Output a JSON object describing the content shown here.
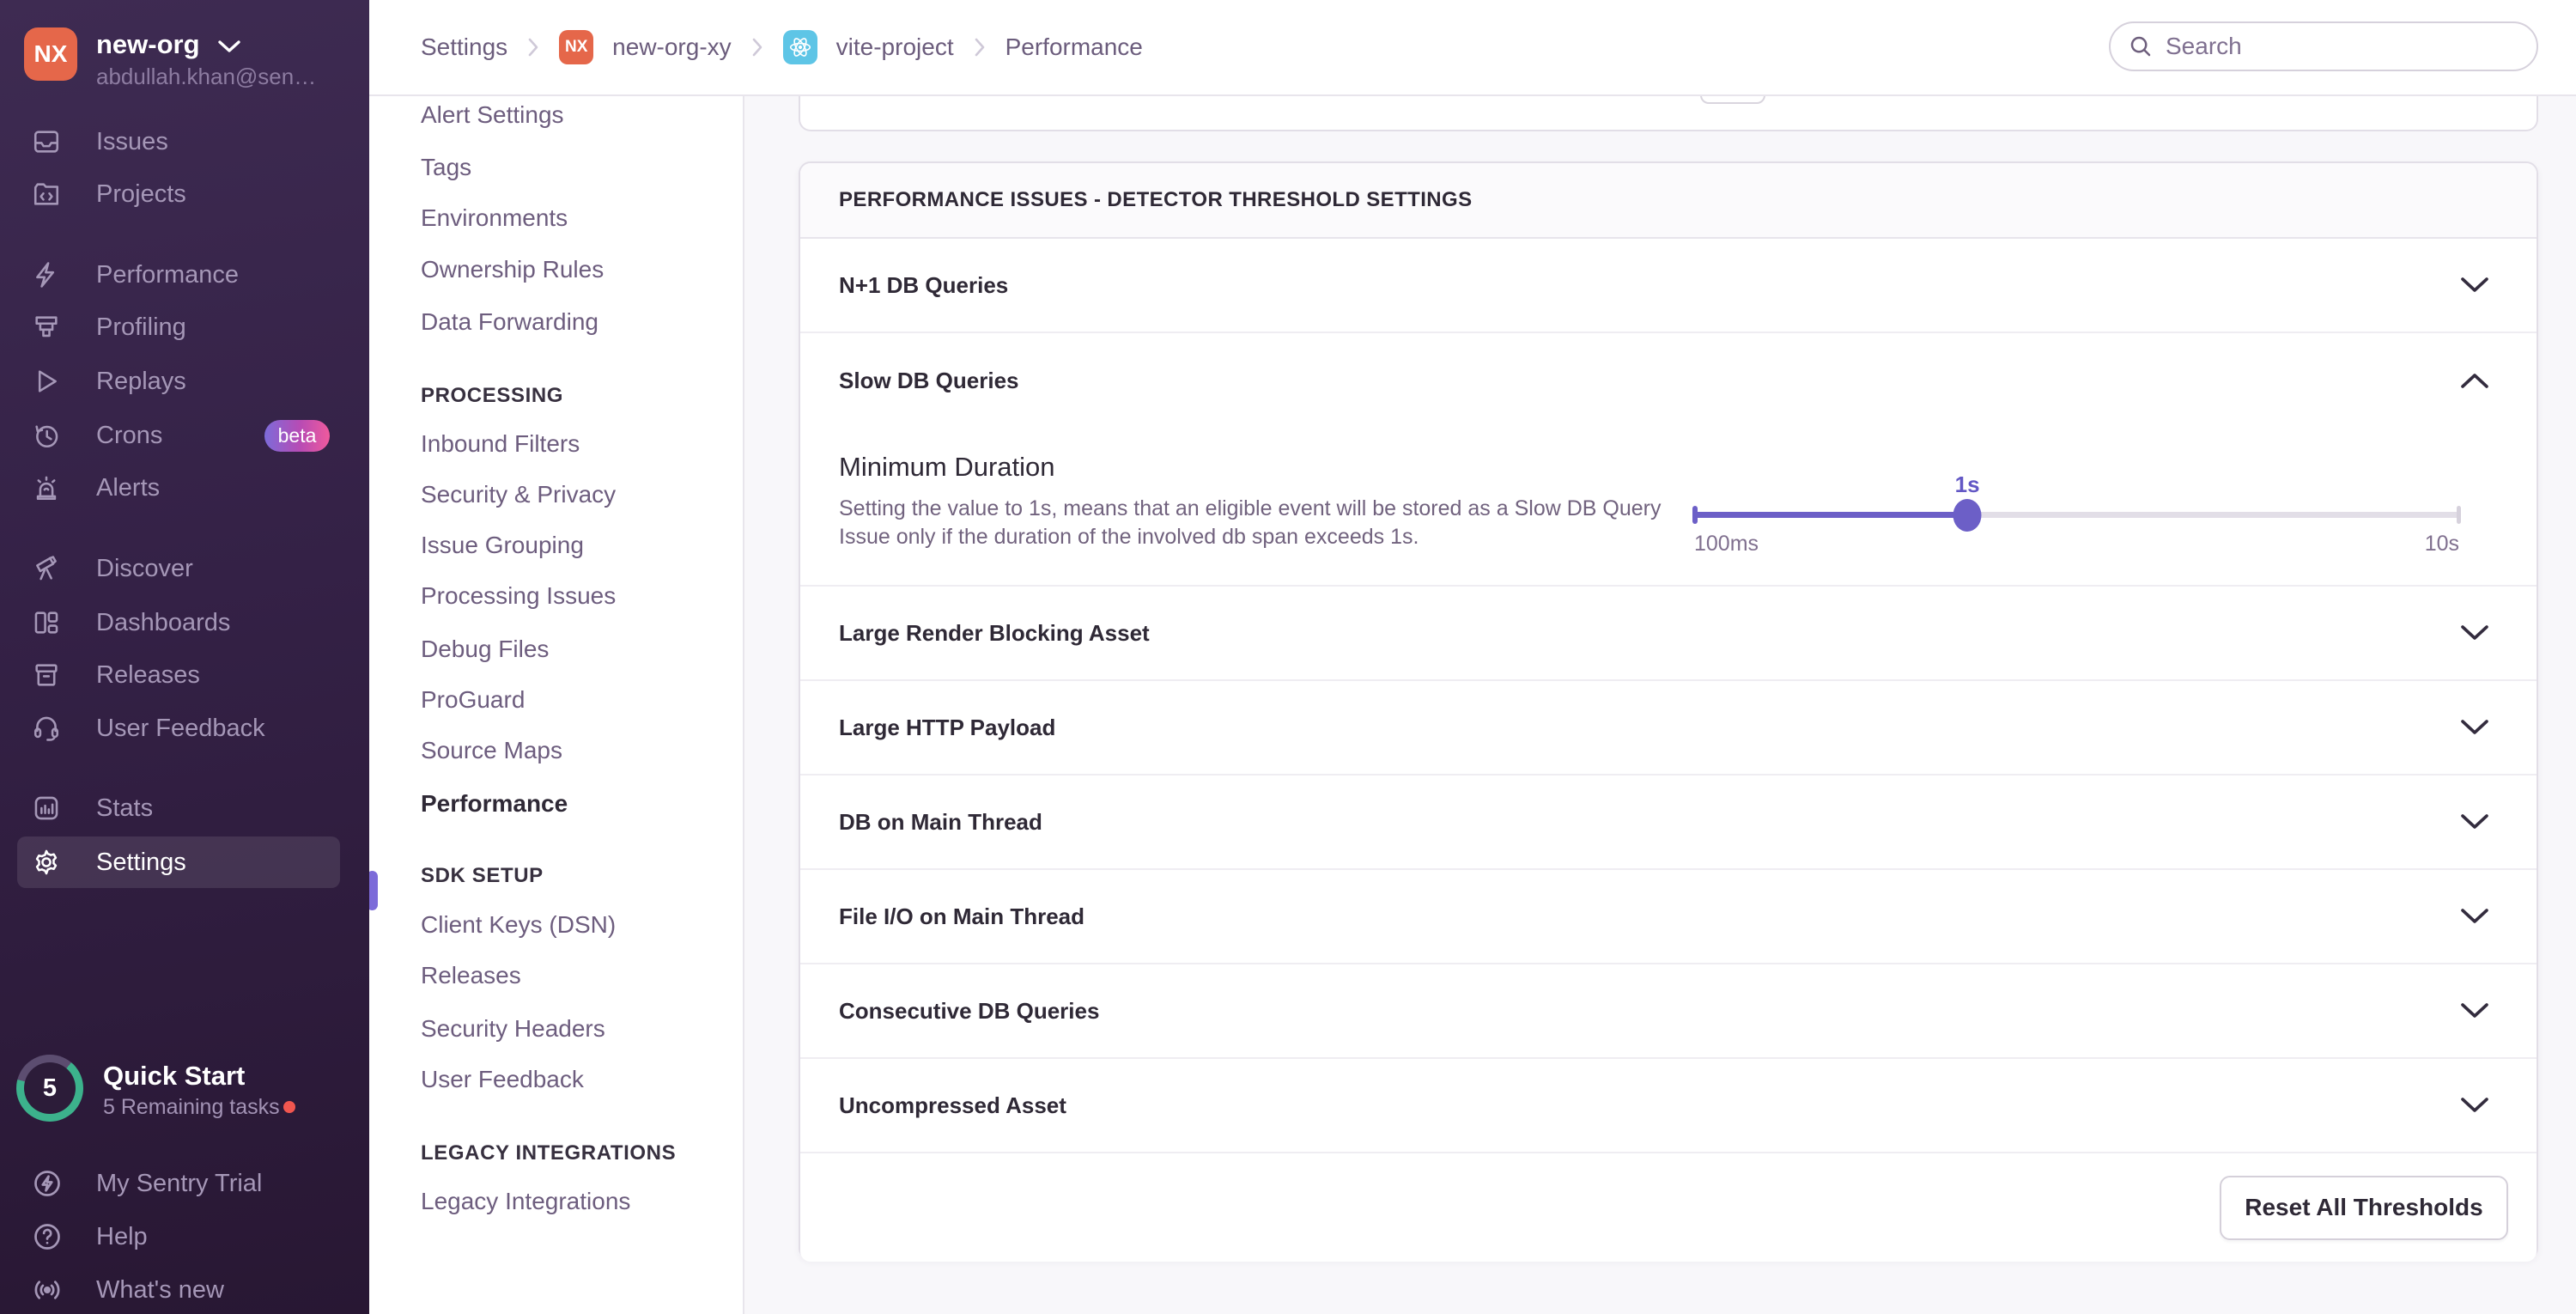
{
  "org": {
    "initials": "NX",
    "name": "new-org",
    "email": "abdullah.khan@sen…"
  },
  "sidebar": {
    "items": [
      {
        "label": "Issues"
      },
      {
        "label": "Projects"
      },
      {
        "label": "Performance"
      },
      {
        "label": "Profiling"
      },
      {
        "label": "Replays"
      },
      {
        "label": "Crons",
        "badge": "beta"
      },
      {
        "label": "Alerts"
      },
      {
        "label": "Discover"
      },
      {
        "label": "Dashboards"
      },
      {
        "label": "Releases"
      },
      {
        "label": "User Feedback"
      },
      {
        "label": "Stats"
      },
      {
        "label": "Settings"
      }
    ]
  },
  "quickstart": {
    "count": "5",
    "title": "Quick Start",
    "subtitle": "5 Remaining tasks"
  },
  "sidebar_footer": {
    "items": [
      {
        "label": "My Sentry Trial"
      },
      {
        "label": "Help"
      },
      {
        "label": "What's new"
      }
    ]
  },
  "breadcrumb": {
    "org_chip": "NX",
    "items": [
      "Settings",
      "new-org-xy",
      "vite-project",
      "Performance"
    ]
  },
  "search": {
    "placeholder": "Search"
  },
  "settings_nav": {
    "groups": [
      {
        "header": "",
        "items": [
          {
            "label": "Alert Settings"
          },
          {
            "label": "Tags"
          },
          {
            "label": "Environments"
          },
          {
            "label": "Ownership Rules"
          },
          {
            "label": "Data Forwarding"
          }
        ]
      },
      {
        "header": "PROCESSING",
        "items": [
          {
            "label": "Inbound Filters"
          },
          {
            "label": "Security & Privacy"
          },
          {
            "label": "Issue Grouping"
          },
          {
            "label": "Processing Issues"
          },
          {
            "label": "Debug Files"
          },
          {
            "label": "ProGuard"
          },
          {
            "label": "Source Maps"
          },
          {
            "label": "Performance"
          }
        ]
      },
      {
        "header": "SDK SETUP",
        "items": [
          {
            "label": "Client Keys (DSN)"
          },
          {
            "label": "Releases"
          },
          {
            "label": "Security Headers"
          },
          {
            "label": "User Feedback"
          }
        ]
      },
      {
        "header": "LEGACY INTEGRATIONS",
        "items": [
          {
            "label": "Legacy Integrations"
          }
        ]
      }
    ]
  },
  "panel": {
    "title": "PERFORMANCE ISSUES - DETECTOR THRESHOLD SETTINGS",
    "detectors": [
      {
        "label": "N+1 DB Queries"
      },
      {
        "label": "Slow DB Queries"
      },
      {
        "label": "Large Render Blocking Asset"
      },
      {
        "label": "Large HTTP Payload"
      },
      {
        "label": "DB on Main Thread"
      },
      {
        "label": "File I/O on Main Thread"
      },
      {
        "label": "Consecutive DB Queries"
      },
      {
        "label": "Uncompressed Asset"
      }
    ],
    "slow_db": {
      "heading": "Minimum Duration",
      "description": "Setting the value to 1s, means that an eligible event will be stored as a Slow DB Query Issue only if the duration of the involved db span exceeds 1s.",
      "value_label": "1s",
      "min_label": "100ms",
      "max_label": "10s"
    },
    "reset_label": "Reset All Thresholds"
  },
  "colors": {
    "accent": "#6c5fc7",
    "active_bar": "#7c6bd9",
    "avatar": "#e5674a",
    "react_chip": "#5ec5e6",
    "ring_done": "#3cb28c",
    "alert_dot": "#f1564f",
    "beta_gradient_start": "#7d6bd9",
    "beta_gradient_end": "#ef5a9d"
  }
}
